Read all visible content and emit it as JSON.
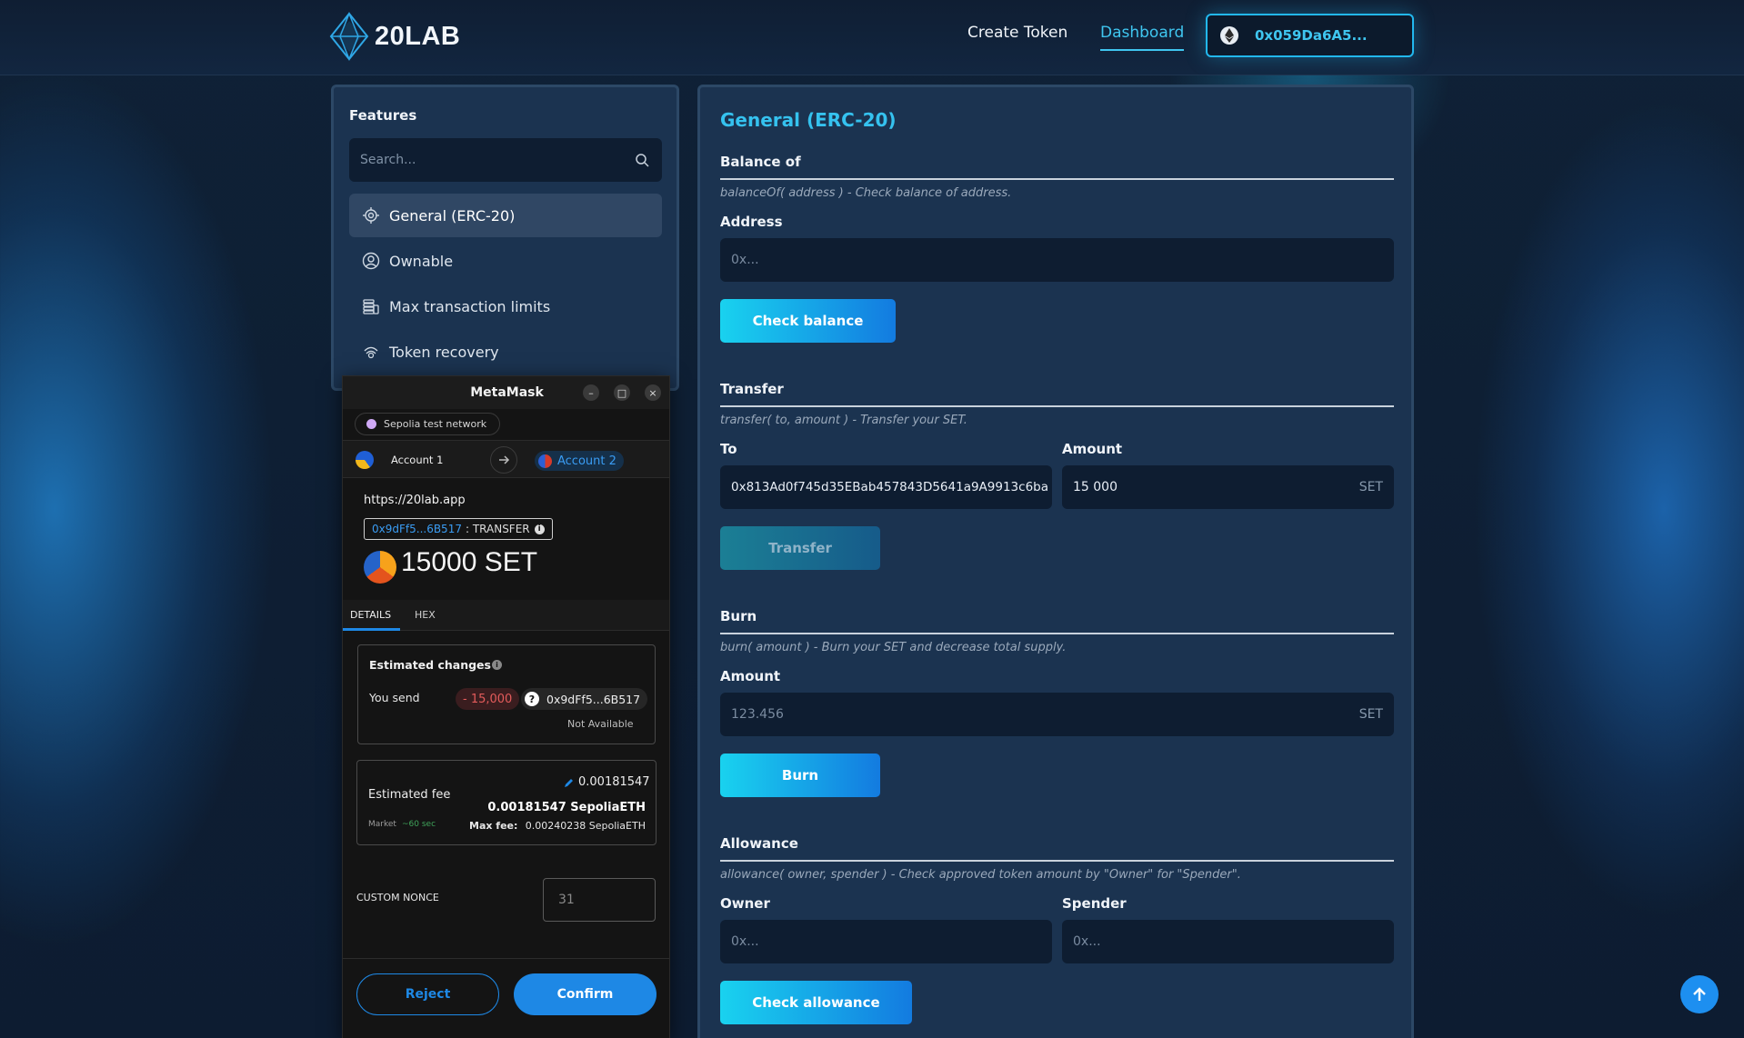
{
  "header": {
    "brand": "20LAB",
    "nav": {
      "create_token": "Create Token",
      "dashboard": "Dashboard"
    },
    "wallet_address": "0x059Da6A5..."
  },
  "features": {
    "title": "Features",
    "search_placeholder": "Search...",
    "items": [
      {
        "label": "General (ERC-20)",
        "icon": "chip-gear-icon",
        "active": true
      },
      {
        "label": "Ownable",
        "icon": "user-circle-icon",
        "active": false
      },
      {
        "label": "Max transaction limits",
        "icon": "coin-stack-icon",
        "active": false
      },
      {
        "label": "Token recovery",
        "icon": "recovery-icon",
        "active": false
      }
    ]
  },
  "main": {
    "title": "General (ERC-20)",
    "balance": {
      "title": "Balance of",
      "desc": "balanceOf( address ) - Check balance of address.",
      "address_label": "Address",
      "address_placeholder": "0x...",
      "button": "Check balance"
    },
    "transfer": {
      "title": "Transfer",
      "desc": "transfer( to, amount ) - Transfer your SET.",
      "to_label": "To",
      "to_value": "0x813Ad0f745d35EBab457843D5641a9A9913c6ba",
      "amount_label": "Amount",
      "amount_value": "15 000",
      "unit": "SET",
      "button": "Transfer"
    },
    "burn": {
      "title": "Burn",
      "desc": "burn( amount ) - Burn your SET and decrease total supply.",
      "amount_label": "Amount",
      "amount_placeholder": "123.456",
      "unit": "SET",
      "button": "Burn"
    },
    "allowance": {
      "title": "Allowance",
      "desc": "allowance( owner, spender ) - Check approved token amount by \"Owner\" for \"Spender\".",
      "owner_label": "Owner",
      "owner_placeholder": "0x...",
      "spender_label": "Spender",
      "spender_placeholder": "0x...",
      "button": "Check allowance"
    }
  },
  "metamask": {
    "title": "MetaMask",
    "network": "Sepolia test network",
    "from_account": "Account 1",
    "to_account": "Account 2",
    "origin": "https://20lab.app",
    "contract_short": "0x9dFf5...6B517",
    "method": ": TRANSFER",
    "amount": "15000 SET",
    "tabs": [
      "DETAILS",
      "HEX"
    ],
    "estimated_changes": {
      "title": "Estimated changes",
      "you_send_label": "You send",
      "you_send_value": "- 15,000",
      "token": "0x9dFf5...6B517",
      "fiat": "Not Available"
    },
    "fee": {
      "label": "Estimated fee",
      "value_top": "0.00181547",
      "value_main": "0.00181547 SepoliaETH",
      "market": "Market",
      "market_time": "~60 sec",
      "max_fee_label": "Max fee:",
      "max_fee_value": "0.00240238 SepoliaETH"
    },
    "custom_nonce_label": "CUSTOM NONCE",
    "custom_nonce_value": "31",
    "reject": "Reject",
    "confirm": "Confirm"
  }
}
